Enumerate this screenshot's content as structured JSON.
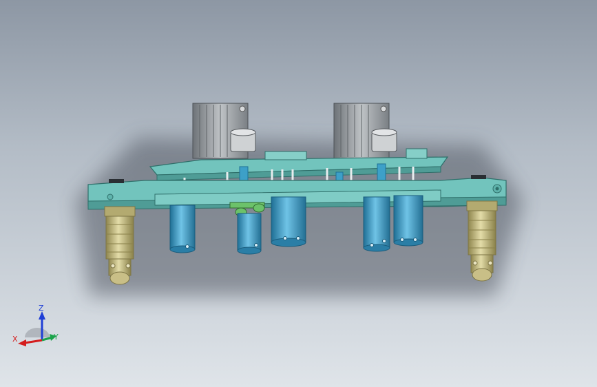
{
  "viewport": {
    "colors": {
      "bg_top": "#8d97a4",
      "bg_bottom": "#dfe4e9",
      "plate": "#72c4bd",
      "plate_edge": "#2f6f6a",
      "motor": "#9da2a6",
      "motor_dark": "#6e7378",
      "cylinder": "#45a6cf",
      "cylinder_dark": "#1f6f95",
      "foot": "#c9bf87",
      "foot_dark": "#8f864f",
      "accent_green": "#6cc26a"
    }
  },
  "triad": {
    "z_label": "Z",
    "x_label": "X",
    "y_label": "Y",
    "colors": {
      "z": "#1f3fd6",
      "x": "#d41d1d",
      "y": "#1aa34a"
    }
  }
}
